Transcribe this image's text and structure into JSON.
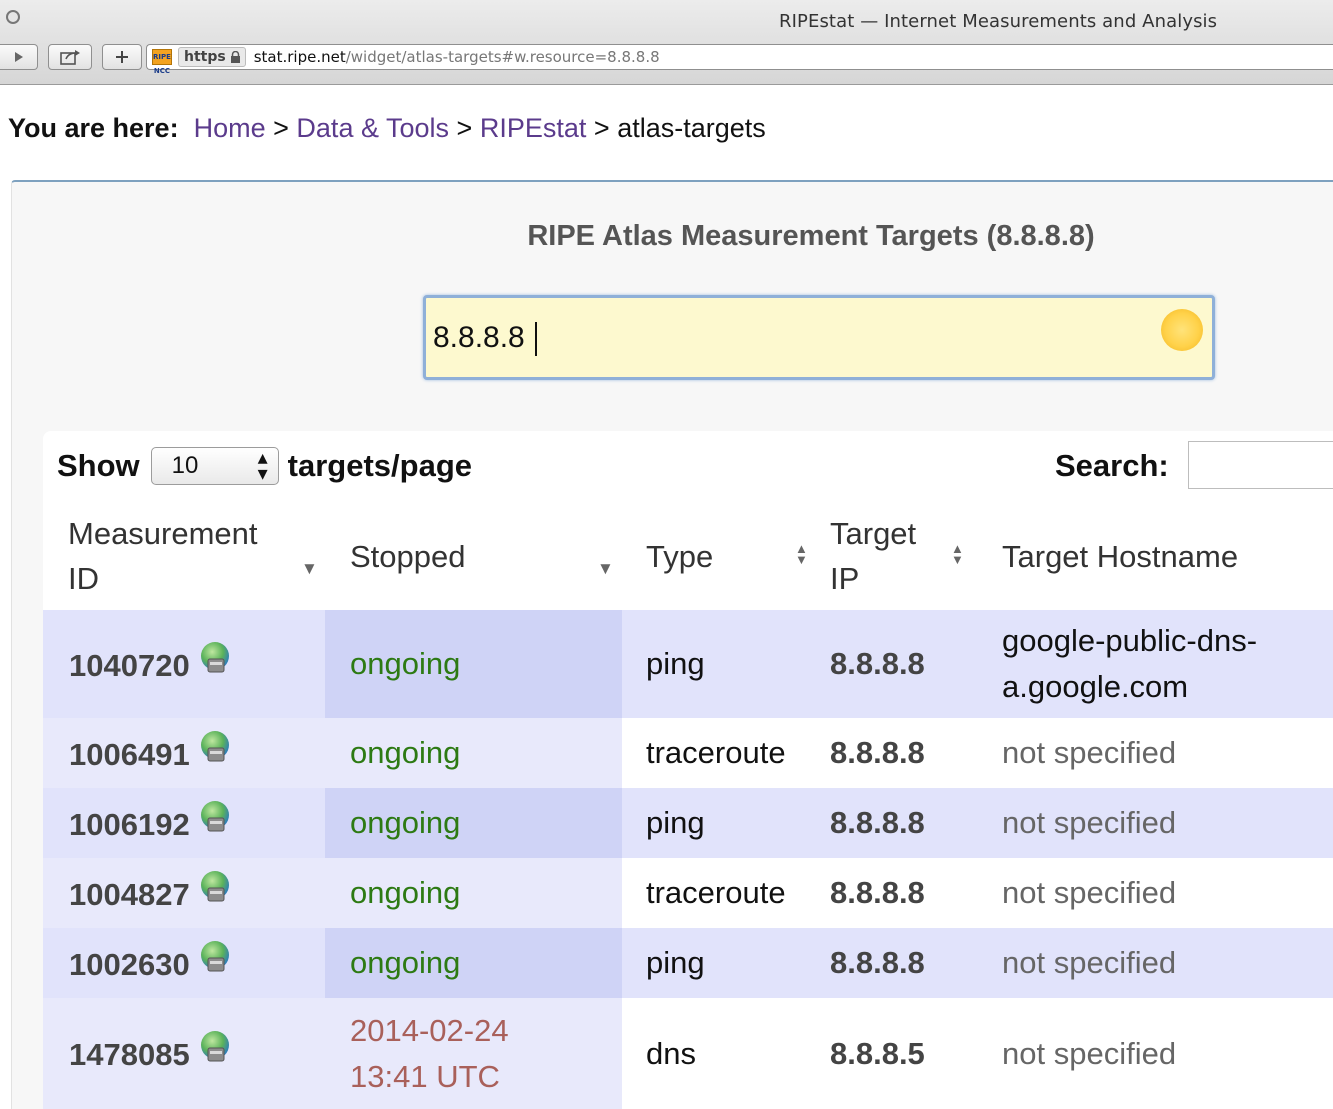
{
  "browser": {
    "window_title": "RIPEstat — Internet Measurements and Analysis",
    "favicon_text": "RIPE NCC",
    "https_label": "https",
    "url_host": "stat.ripe.net",
    "url_path": "/widget/atlas-targets#w.resource=8.8.8.8"
  },
  "breadcrumb": {
    "label": "You are here:",
    "items": [
      "Home",
      "Data & Tools",
      "RIPEstat"
    ],
    "separator": ">",
    "current": "atlas-targets"
  },
  "widget": {
    "title": "RIPE Atlas Measurement Targets (8.8.8.8)",
    "resource_value": "8.8.8.8"
  },
  "controls": {
    "show_label": "Show",
    "page_size": "10",
    "page_size_suffix": "targets/page",
    "search_label": "Search:",
    "search_value": ""
  },
  "table": {
    "columns": [
      {
        "line1": "Measurement",
        "line2": "ID",
        "sort": "desc"
      },
      {
        "line1": "Stopped",
        "line2": "",
        "sort": "desc"
      },
      {
        "line1": "Type",
        "line2": "",
        "sort": "both"
      },
      {
        "line1": "Target",
        "line2": "IP",
        "sort": "both"
      },
      {
        "line1": "Target Hostname",
        "line2": "",
        "sort": "none"
      }
    ],
    "rows": [
      {
        "id": "1040720",
        "stopped": "ongoing",
        "type": "ping",
        "ip": "8.8.8.8",
        "host_line1": "google-public-dns-",
        "host_line2": "a.google.com"
      },
      {
        "id": "1006491",
        "stopped": "ongoing",
        "type": "traceroute",
        "ip": "8.8.8.8",
        "host_line1": "not specified",
        "host_line2": ""
      },
      {
        "id": "1006192",
        "stopped": "ongoing",
        "type": "ping",
        "ip": "8.8.8.8",
        "host_line1": "not specified",
        "host_line2": ""
      },
      {
        "id": "1004827",
        "stopped": "ongoing",
        "type": "traceroute",
        "ip": "8.8.8.8",
        "host_line1": "not specified",
        "host_line2": ""
      },
      {
        "id": "1002630",
        "stopped": "ongoing",
        "type": "ping",
        "ip": "8.8.8.8",
        "host_line1": "not specified",
        "host_line2": ""
      },
      {
        "id": "1478085",
        "stopped_line1": "2014-02-24",
        "stopped_line2": "13:41 UTC",
        "type": "dns",
        "ip": "8.8.8.5",
        "host_line1": "not specified",
        "host_line2": ""
      }
    ]
  },
  "icons": {
    "row_link": "globe-icon",
    "resource_status": "sun-icon"
  },
  "colors": {
    "ongoing": "#2d7a13",
    "stopped_date": "#a9605a",
    "link": "#5b3b8c",
    "row_highlight": "#e1e3fb"
  }
}
